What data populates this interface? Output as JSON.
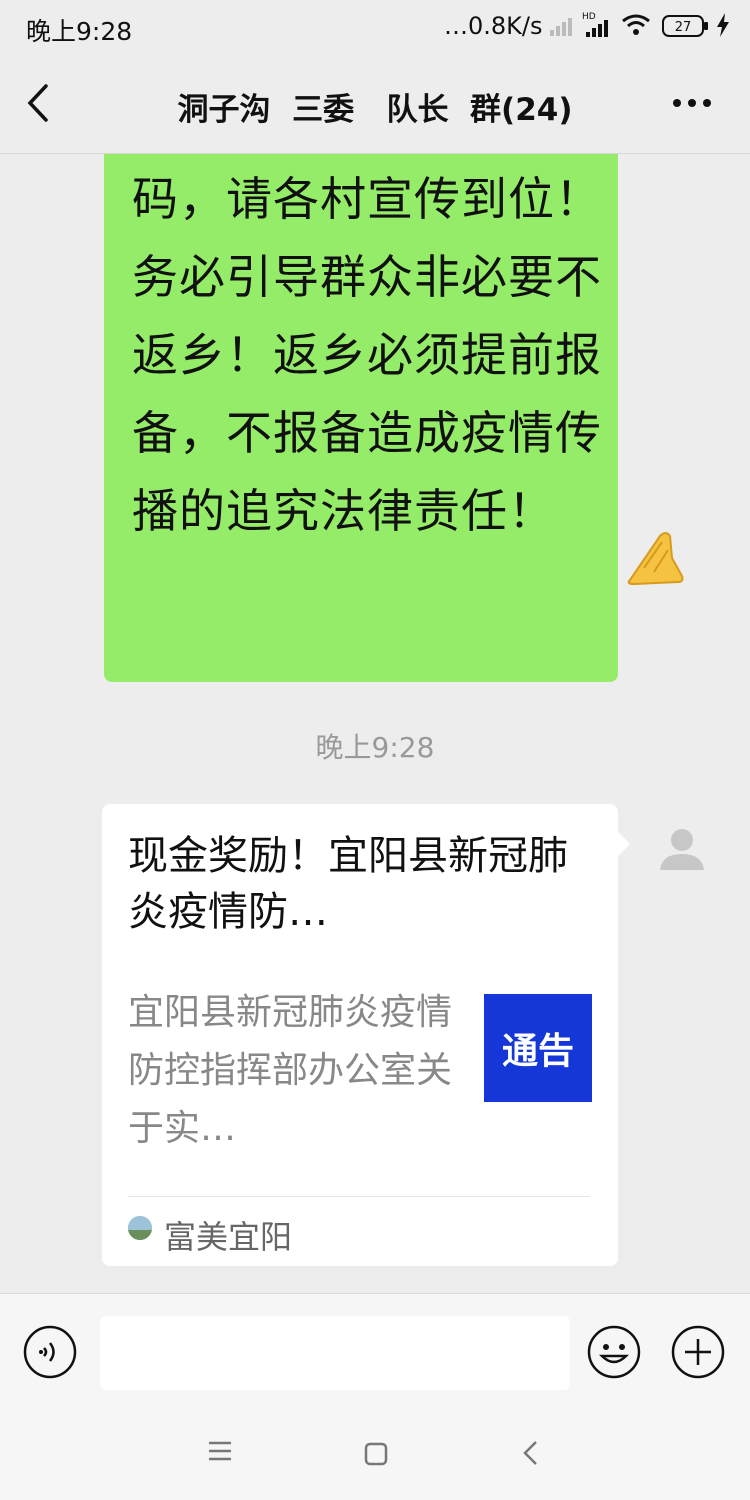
{
  "status_bar": {
    "time": "晚上9:28",
    "network_speed": "…0.8K/s",
    "hd_label": "HD",
    "battery_level": "27",
    "icons": [
      "signal-icon",
      "hd-signal-icon",
      "wifi-icon",
      "battery-icon",
      "charging-icon"
    ]
  },
  "navbar": {
    "title": "洞子沟  三委   队长  群(24)",
    "icons": [
      "back-icon",
      "more-icon"
    ]
  },
  "messages": {
    "green_bubble_text": "到上卫院提供申请转绿码，请各村宣传到位！务必引导群众非必要不返乡！返乡必须提前报备，不报备造成疫情传播的追究法律责任！",
    "green_bubble_emoji": "palms-together-icon",
    "timestamp": "晚上9:28",
    "link_card": {
      "title": "现金奖励！宜阳县新冠肺炎疫情防…",
      "description": "宜阳县新冠肺炎疫情防控指挥部办公室关于实…",
      "thumbnail_text": "通告",
      "source_name": "富美宜阳"
    }
  },
  "input_bar": {
    "placeholder": "",
    "icons": [
      "voice-icon",
      "emoji-icon",
      "plus-icon"
    ]
  },
  "system_nav": {
    "icons": [
      "menu-icon",
      "home-icon",
      "back-nav-icon"
    ]
  },
  "colors": {
    "background": "#ededed",
    "green_bubble": "#95ec69",
    "thumbnail_blue": "#1537d8"
  }
}
